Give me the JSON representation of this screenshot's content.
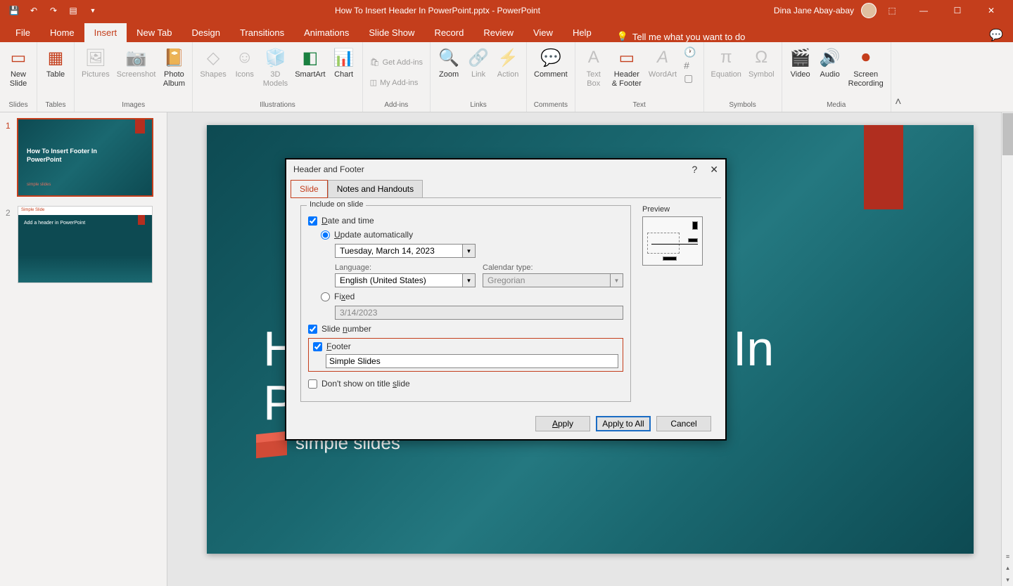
{
  "titlebar": {
    "doc_title": "How To Insert Header In PowerPoint.pptx  -  PowerPoint",
    "user_name": "Dina Jane Abay-abay"
  },
  "tabs": {
    "file": "File",
    "home": "Home",
    "insert": "Insert",
    "newtab": "New Tab",
    "design": "Design",
    "transitions": "Transitions",
    "animations": "Animations",
    "slideshow": "Slide Show",
    "record": "Record",
    "review": "Review",
    "view": "View",
    "help": "Help",
    "tellme": "Tell me what you want to do"
  },
  "ribbon": {
    "new_slide": "New\nSlide",
    "table": "Table",
    "pictures": "Pictures",
    "screenshot": "Screenshot",
    "photo_album": "Photo\nAlbum",
    "shapes": "Shapes",
    "icons": "Icons",
    "models3d": "3D\nModels",
    "smartart": "SmartArt",
    "chart": "Chart",
    "get_addins": "Get Add-ins",
    "my_addins": "My Add-ins",
    "zoom": "Zoom",
    "link": "Link",
    "action": "Action",
    "comment": "Comment",
    "textbox": "Text\nBox",
    "header_footer": "Header\n& Footer",
    "wordart": "WordArt",
    "equation": "Equation",
    "symbol": "Symbol",
    "video": "Video",
    "audio": "Audio",
    "screen_recording": "Screen\nRecording",
    "groups": {
      "slides": "Slides",
      "tables": "Tables",
      "images": "Images",
      "illustrations": "Illustrations",
      "addins": "Add-ins",
      "links": "Links",
      "comments": "Comments",
      "text": "Text",
      "symbols": "Symbols",
      "media": "Media"
    }
  },
  "thumbs": {
    "s1_num": "1",
    "s1_text": "How To Insert Footer In PowerPoint",
    "s1_logo": "simple slides",
    "s2_num": "2",
    "s2_header": "Simple Slide",
    "s2_text": "Add a header in PowerPoint"
  },
  "canvas": {
    "title_l1": "How To Insert Footer In",
    "title_l2": "PowerPoint",
    "logo_text": "simple slides"
  },
  "dialog": {
    "title": "Header and Footer",
    "tab_slide": "Slide",
    "tab_notes": "Notes and Handouts",
    "include_legend": "Include on slide",
    "date_time": "Date and time",
    "update_auto": "Update automatically",
    "date_value": "Tuesday, March 14, 2023",
    "language_label": "Language:",
    "language_value": "English (United States)",
    "calendar_label": "Calendar type:",
    "calendar_value": "Gregorian",
    "fixed": "Fixed",
    "fixed_value": "3/14/2023",
    "slide_number": "Slide number",
    "footer": "Footer",
    "footer_value": "Simple Slides",
    "dont_show": "Don't show on title slide",
    "preview": "Preview",
    "apply": "Apply",
    "apply_all": "Apply to All",
    "cancel": "Cancel"
  }
}
